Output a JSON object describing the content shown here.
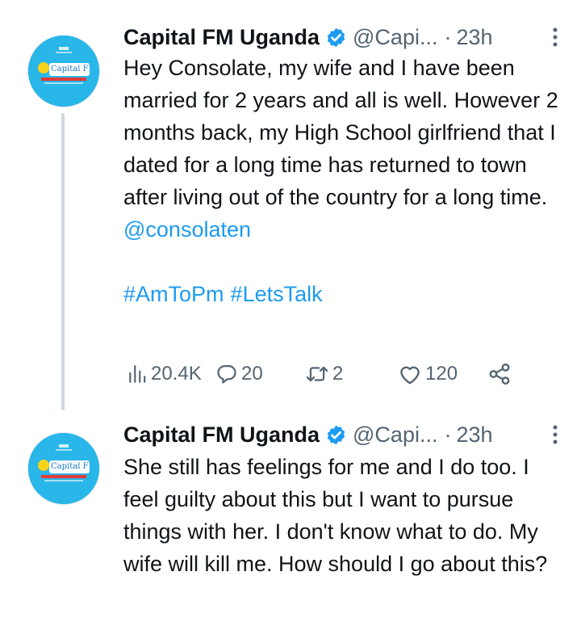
{
  "tweets": [
    {
      "author_name": "Capital FM Uganda",
      "handle": "@Capi...",
      "separator": "·",
      "time": "23h",
      "text": "Hey Consolate, my wife and I have been married for 2 years and all is well. However 2 months back, my High School girlfriend that I dated for a long time has returned to town after living out of the country for a long time.",
      "mention": "@consolaten",
      "hashtags": [
        "#AmToPm",
        "#LetsTalk"
      ],
      "stats": {
        "views": "20.4K",
        "replies": "20",
        "retweets": "2",
        "likes": "120"
      },
      "avatar_label": "Capital FM"
    },
    {
      "author_name": "Capital FM Uganda",
      "handle": "@Capi...",
      "separator": "·",
      "time": "23h",
      "text": "She still has feelings for me and I do too. I feel guilty about this but I want to pursue things with her. I don't know what to do. My wife will kill me. How should I go about this?",
      "avatar_label": "Capital FM"
    }
  ],
  "colors": {
    "link": "#1d9bf0",
    "secondary_text": "#536471",
    "primary_text": "#0f1419",
    "avatar_bg": "#29b6e8",
    "thread_line": "#cfd9de"
  },
  "icons": [
    "verified-badge-icon",
    "more-options-icon",
    "views-icon",
    "reply-icon",
    "retweet-icon",
    "like-icon",
    "share-icon"
  ]
}
